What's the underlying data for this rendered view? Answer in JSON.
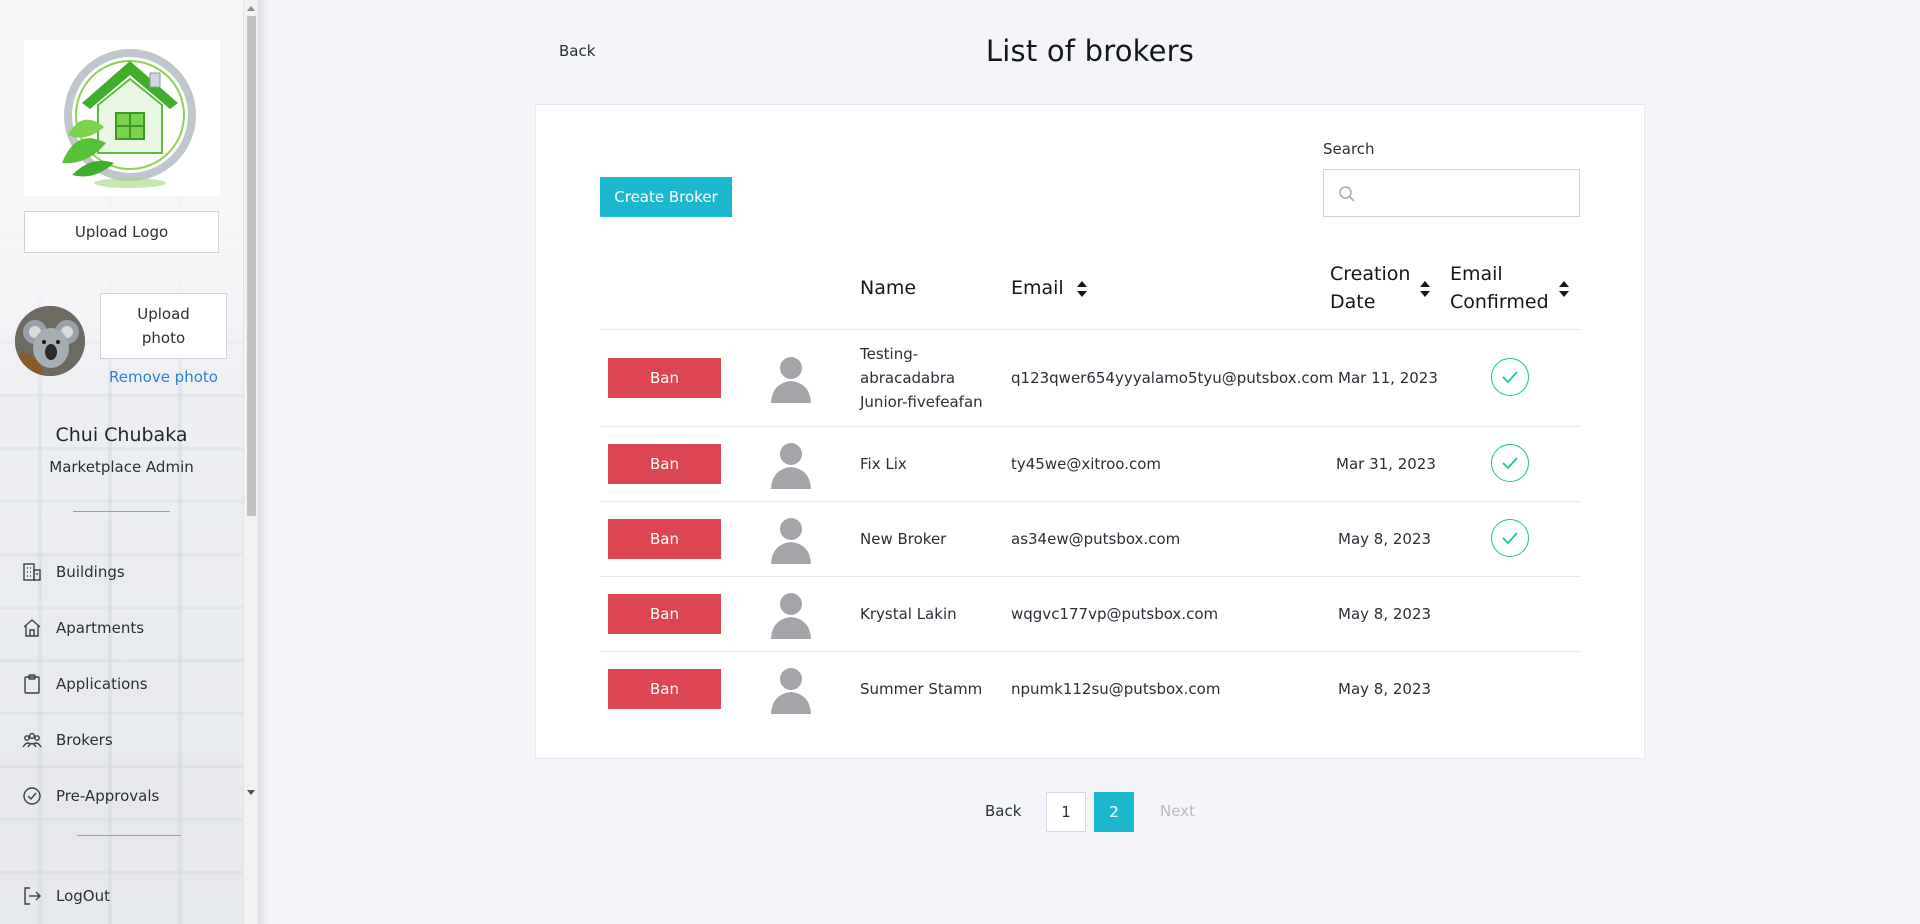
{
  "sidebar": {
    "upload_logo_label": "Upload Logo",
    "upload_photo_label": "Upload photo",
    "remove_photo_label": "Remove photo",
    "user_name": "Chui Chubaka",
    "user_role": "Marketplace Admin",
    "nav": [
      {
        "label": "Buildings",
        "icon": "building-icon"
      },
      {
        "label": "Apartments",
        "icon": "home-icon"
      },
      {
        "label": "Applications",
        "icon": "clipboard-icon"
      },
      {
        "label": "Brokers",
        "icon": "people-icon"
      },
      {
        "label": "Pre-Approvals",
        "icon": "check-circle-icon"
      }
    ],
    "logout_label": "LogOut"
  },
  "header": {
    "back_label": "Back",
    "title": "List of brokers"
  },
  "toolbar": {
    "create_label": "Create Broker",
    "search_label": "Search",
    "search_value": ""
  },
  "table": {
    "columns": {
      "name": "Name",
      "email": "Email",
      "creation_date": "Creation Date",
      "email_confirmed": "Email Confirmed"
    },
    "ban_label": "Ban",
    "rows": [
      {
        "name": "Testing-abracadabra Junior-fivefeafan",
        "email": "q123qwer654yyyalamo5tyu@putsbox.com",
        "date": "Mar 11, 2023",
        "confirmed": true
      },
      {
        "name": "Fix Lix",
        "email": "ty45we@xitroo.com",
        "date": "Mar 31, 2023",
        "confirmed": true
      },
      {
        "name": "New Broker",
        "email": "as34ew@putsbox.com",
        "date": "May 8, 2023",
        "confirmed": true
      },
      {
        "name": "Krystal Lakin",
        "email": "wqgvc177vp@putsbox.com",
        "date": "May 8, 2023",
        "confirmed": false
      },
      {
        "name": "Summer Stamm",
        "email": "npumk112su@putsbox.com",
        "date": "May 8, 2023",
        "confirmed": false
      }
    ]
  },
  "pagination": {
    "back_label": "Back",
    "pages": [
      "1",
      "2"
    ],
    "current_page": "2",
    "next_label": "Next"
  },
  "colors": {
    "accent": "#1bb8d0",
    "danger": "#dc4552",
    "success": "#18c29c"
  }
}
